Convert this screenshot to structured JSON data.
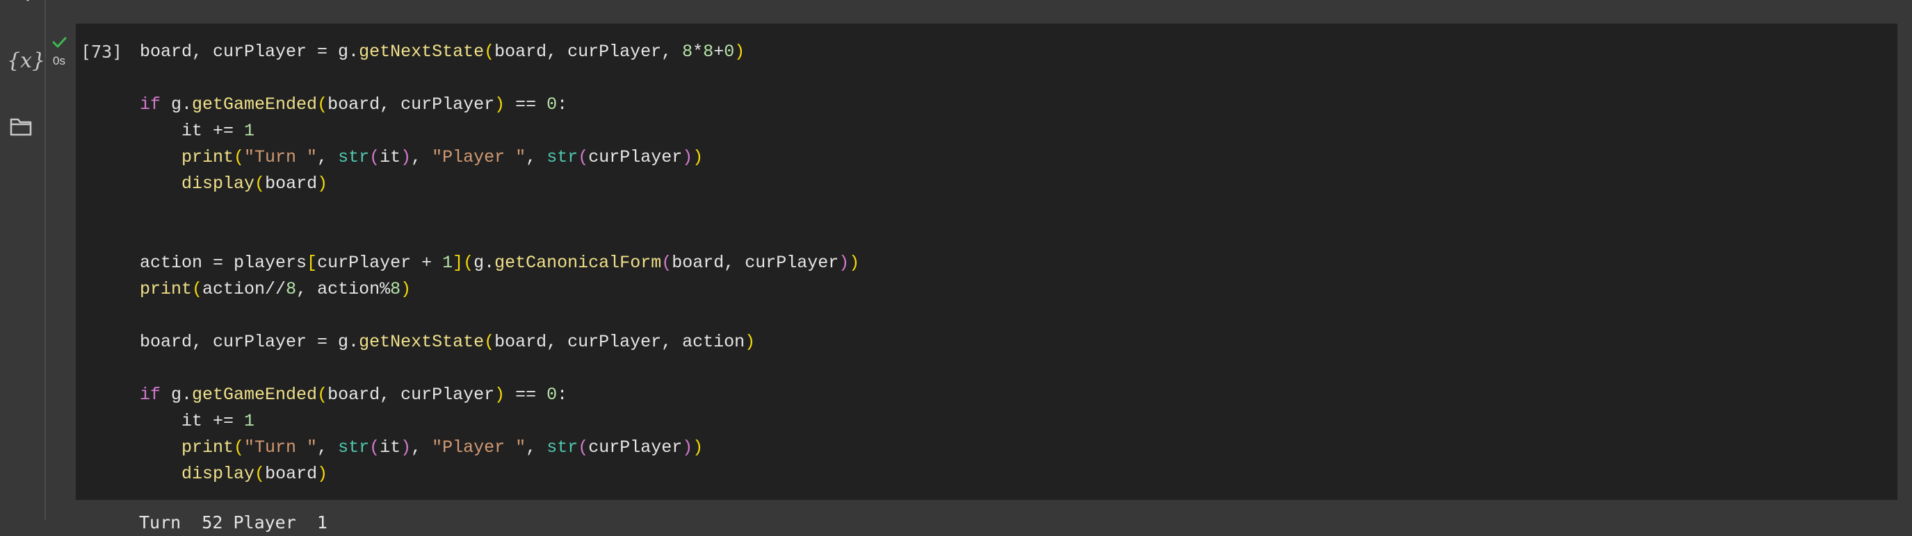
{
  "sidebar": {
    "icons": [
      "search-icon",
      "variables-icon",
      "folder-icon"
    ],
    "variables_glyph": "{x}"
  },
  "cell": {
    "execution_count": "[73]",
    "run_time": "0s",
    "status": "success",
    "colors": {
      "keyword": "#d47ad0",
      "function": "#f0e08a",
      "builtin": "#4ec9b0",
      "string": "#d19a72",
      "number": "#b5e3a8",
      "bracket_outer": "#f5d90a",
      "bracket_inner": "#d47ad0",
      "success_check": "#3fb950"
    },
    "code": {
      "l1": {
        "a": "board, curPlayer = g.",
        "b": "getNextState",
        "c": "(",
        "d": "board, curPlayer, ",
        "e": "8",
        "f": "*",
        "g": "8",
        "h": "+",
        "i": "0",
        "j": ")"
      },
      "l3": {
        "a": "if",
        "b": " g.",
        "c": "getGameEnded",
        "d": "(",
        "e": "board, curPlayer",
        "f": ")",
        "g": " == ",
        "h": "0",
        "i": ":"
      },
      "l4": {
        "a": "    it += ",
        "b": "1"
      },
      "l5": {
        "a": "print",
        "b": "(",
        "c": "\"Turn \"",
        "d": ", ",
        "e": "str",
        "f": "(",
        "g": "it",
        "h": ")",
        "i": ", ",
        "j": "\"Player \"",
        "k": ", ",
        "l": "str",
        "m": "(",
        "n": "curPlayer",
        "o": ")",
        "p": ")"
      },
      "l6": {
        "a": "display",
        "b": "(",
        "c": "board",
        "d": ")"
      },
      "l9": {
        "a": "action = players",
        "b": "[",
        "c": "curPlayer + ",
        "d": "1",
        "e": "]",
        "f": "(",
        "g": "g.",
        "h": "getCanonicalForm",
        "i": "(",
        "j": "board, curPlayer",
        "k": ")",
        "l": ")"
      },
      "l10": {
        "a": "print",
        "b": "(",
        "c": "action//",
        "d": "8",
        "e": ", action%",
        "f": "8",
        "g": ")"
      },
      "l12": {
        "a": "board, curPlayer = g.",
        "b": "getNextState",
        "c": "(",
        "d": "board, curPlayer, action",
        "e": ")"
      },
      "l14": {
        "a": "if",
        "b": " g.",
        "c": "getGameEnded",
        "d": "(",
        "e": "board, curPlayer",
        "f": ")",
        "g": " == ",
        "h": "0",
        "i": ":"
      },
      "l15": {
        "a": "    it += ",
        "b": "1"
      },
      "l16": {
        "a": "print",
        "b": "(",
        "c": "\"Turn \"",
        "d": ", ",
        "e": "str",
        "f": "(",
        "g": "it",
        "h": ")",
        "i": ", ",
        "j": "\"Player \"",
        "k": ", ",
        "l": "str",
        "m": "(",
        "n": "curPlayer",
        "o": ")",
        "p": ")"
      },
      "l17": {
        "a": "display",
        "b": "(",
        "c": "board",
        "d": ")"
      }
    }
  },
  "output": {
    "partial_text": "Turn  52 Player  1"
  }
}
